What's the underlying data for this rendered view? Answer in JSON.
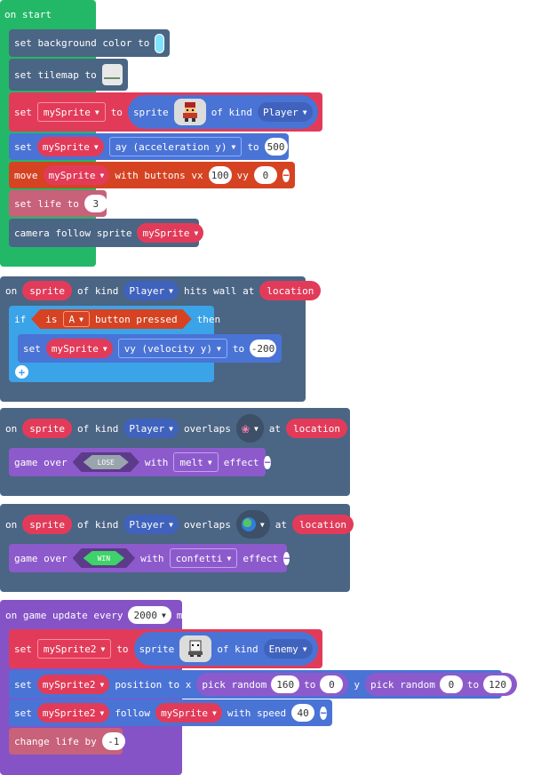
{
  "colors": {
    "events_green": "#23b868",
    "scene_blue": "#4b6584",
    "sprites_red": "#e23b59",
    "sprites_blue": "#4a73d6",
    "controller_orange": "#d54322",
    "info_pink": "#c8617a",
    "logic_blue": "#3ba3e8",
    "game_purple": "#8d5acc",
    "update_purple": "#8553c6",
    "lightblue_swatch": "#7fe3ff"
  },
  "on_start": {
    "title": "on start",
    "set_bg": {
      "label": "set background color to",
      "color_name": "light blue"
    },
    "set_tilemap": {
      "label": "set tilemap to"
    },
    "set_sprite": {
      "set": "set",
      "var": "mySprite",
      "to": "to",
      "sprite": "sprite",
      "image_icon": "hero-sprite-icon",
      "of_kind": "of kind",
      "kind": "Player"
    },
    "set_ay": {
      "set": "set",
      "var": "mySprite",
      "prop": "ay (acceleration y)",
      "to": "to",
      "value": "500"
    },
    "move": {
      "move": "move",
      "var": "mySprite",
      "with_buttons": "with buttons vx",
      "vx": "100",
      "vy_label": "vy",
      "vy": "0"
    },
    "set_life": {
      "label": "set life to",
      "value": "3"
    },
    "camera": {
      "label": "camera follow sprite",
      "var": "mySprite"
    }
  },
  "hits_wall": {
    "on": "on",
    "sprite": "sprite",
    "of_kind": "of kind",
    "kind": "Player",
    "hits_wall_at": "hits wall at",
    "location": "location",
    "if_label": "if",
    "is": "is",
    "button": "A",
    "button_pressed": "button pressed",
    "then": "then",
    "set": {
      "set": "set",
      "var": "mySprite",
      "prop": "vy (velocity y)",
      "to": "to",
      "value": "-200"
    },
    "add_icon": "plus-icon"
  },
  "overlap_lose": {
    "on": "on",
    "sprite": "sprite",
    "of_kind": "of kind",
    "kind": "Player",
    "overlaps": "overlaps",
    "at": "at",
    "location": "location",
    "tile_icon": "coral-tile-icon",
    "game_over": "game over",
    "result": "LOSE",
    "with": "with",
    "effect_name": "melt",
    "effect": "effect"
  },
  "overlap_win": {
    "on": "on",
    "sprite": "sprite",
    "of_kind": "of kind",
    "kind": "Player",
    "overlaps": "overlaps",
    "at": "at",
    "location": "location",
    "tile_icon": "globe-tile-icon",
    "game_over": "game over",
    "result": "WIN",
    "with": "with",
    "effect_name": "confetti",
    "effect": "effect"
  },
  "game_update": {
    "title": "on game update every",
    "interval": "2000",
    "ms": "ms",
    "set_sprite2": {
      "set": "set",
      "var": "mySprite2",
      "to": "to",
      "sprite": "sprite",
      "image_icon": "ghost-sprite-icon",
      "of_kind": "of kind",
      "kind": "Enemy"
    },
    "set_position": {
      "set": "set",
      "var": "mySprite2",
      "position": "position to x",
      "pick_random": "pick random",
      "x_from": "160",
      "to": "to",
      "x_to": "0",
      "y": "y",
      "y_from": "0",
      "y_to": "120"
    },
    "follow": {
      "set": "set",
      "var": "mySprite2",
      "follow": "follow",
      "target": "mySprite",
      "with_speed": "with speed",
      "speed": "40"
    },
    "change_life": {
      "label": "change life by",
      "value": "-1"
    }
  }
}
